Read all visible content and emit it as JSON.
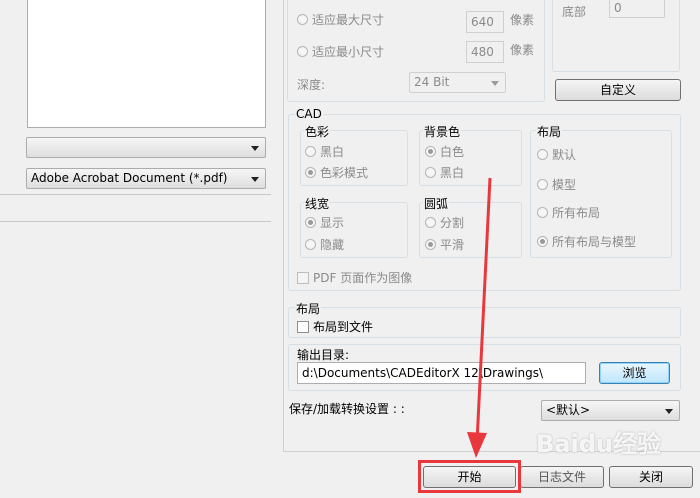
{
  "left": {
    "combo_empty": "",
    "combo_format": "Adobe Acrobat Document (*.pdf)"
  },
  "raster": {
    "fit_max_label": "适应最大尺寸",
    "fit_max_value": "640",
    "fit_max_unit": "像素",
    "fit_min_label": "适应最小尺寸",
    "fit_min_value": "480",
    "fit_min_unit": "像素",
    "depth_label": "深度:",
    "depth_value": "24 Bit"
  },
  "margins": {
    "bottom_label": "底部",
    "bottom_value": "0",
    "custom_button": "自定义"
  },
  "cad": {
    "title": "CAD",
    "color": {
      "title": "色彩",
      "options": [
        "黑白",
        "色彩模式"
      ]
    },
    "background": {
      "title": "背景色",
      "options": [
        "白色",
        "黑白"
      ]
    },
    "layout": {
      "title": "布局",
      "options": [
        "默认",
        "模型",
        "所有布局",
        "所有布局与模型"
      ]
    },
    "lineweight": {
      "title": "线宽",
      "options": [
        "显示",
        "隐藏"
      ]
    },
    "arc": {
      "title": "圆弧",
      "options": [
        "分割",
        "平滑"
      ]
    },
    "pdf_as_image": "PDF 页面作为图像"
  },
  "layout_section": {
    "title": "布局",
    "layout_to_file": "布局到文件"
  },
  "output": {
    "label": "输出目录:",
    "path": "d:\\Documents\\CADEditorX 12\\Drawings\\",
    "browse": "浏览"
  },
  "save_settings": {
    "label": "保存/加载转换设置 : :",
    "value": "<默认>"
  },
  "footer": {
    "start": "开始",
    "log": "日志文件",
    "close": "关闭"
  },
  "watermark": "Baidu经验",
  "annotation_color": "#e8383d"
}
